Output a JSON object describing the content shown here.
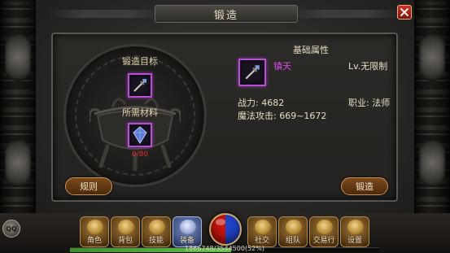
{
  "window": {
    "title": "锻造",
    "close": "close"
  },
  "forge": {
    "target_label": "锻造目标",
    "material_label": "所需材料",
    "material_count": "0/80",
    "rule_button": "规则"
  },
  "attributes": {
    "title": "基础属性",
    "weapon_name": "镇天",
    "level": "Lv.无限制",
    "power": "战力: 4682",
    "profession": "职业: 法师",
    "magic_attack": "魔法攻击: 669~1672",
    "forge_button": "锻造"
  },
  "hud": {
    "buttons": [
      {
        "label": "角色",
        "icon": "character-icon"
      },
      {
        "label": "背包",
        "icon": "bag-icon"
      },
      {
        "label": "技能",
        "icon": "skill-icon"
      },
      {
        "label": "装备",
        "icon": "equipment-icon"
      },
      {
        "label": "社交",
        "icon": "social-icon"
      },
      {
        "label": "组队",
        "icon": "team-icon"
      },
      {
        "label": "交易行",
        "icon": "trade-icon"
      },
      {
        "label": "设置",
        "icon": "settings-icon"
      }
    ],
    "xp_text": "1866748/3544500(52%)",
    "xp_fraction": 0.52,
    "chat_label": "QQ"
  },
  "colors": {
    "epic_border": "#b64fd1",
    "weapon_name": "#d24de6",
    "count_red": "#e0312b",
    "close_red": "#d0322a"
  }
}
